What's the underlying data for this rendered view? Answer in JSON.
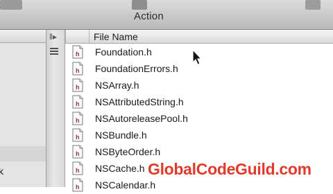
{
  "toolbar": {
    "action_label": "Action"
  },
  "left_pane": {
    "rows": [
      {
        "text": ""
      },
      {
        "text": "k"
      }
    ]
  },
  "divider": {
    "split_icon": "split-view-icon",
    "list_icon": "list-view-icon"
  },
  "file_list": {
    "column_header": "File Name",
    "files": [
      {
        "name": "Foundation.h",
        "icon": "header-file-icon"
      },
      {
        "name": "FoundationErrors.h",
        "icon": "header-file-icon"
      },
      {
        "name": "NSArray.h",
        "icon": "header-file-icon"
      },
      {
        "name": "NSAttributedString.h",
        "icon": "header-file-icon"
      },
      {
        "name": "NSAutoreleasePool.h",
        "icon": "header-file-icon"
      },
      {
        "name": "NSBundle.h",
        "icon": "header-file-icon"
      },
      {
        "name": "NSByteOrder.h",
        "icon": "header-file-icon"
      },
      {
        "name": "NSCache.h",
        "icon": "header-file-icon"
      },
      {
        "name": "NSCalendar.h",
        "icon": "header-file-icon"
      }
    ]
  },
  "watermark": "GlobalCodeGuild.com",
  "colors": {
    "watermark": "#e23a2a",
    "toolbar_top": "#dcdcdc",
    "toolbar_bottom": "#b9b9b9"
  }
}
